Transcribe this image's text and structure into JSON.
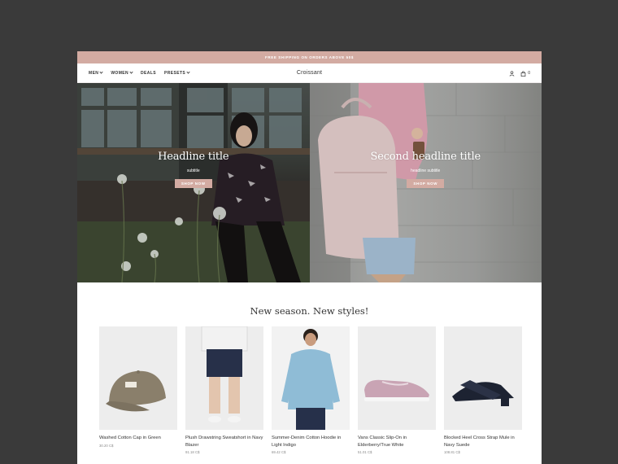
{
  "announcement": "FREE SHIPPING ON ORDERS ABOVE 50$",
  "nav": {
    "brand": "Croissant",
    "items": [
      {
        "label": "MEN",
        "dropdown": true
      },
      {
        "label": "WOMEN",
        "dropdown": true
      },
      {
        "label": "DEALS",
        "dropdown": false
      },
      {
        "label": "PRESETS",
        "dropdown": true
      }
    ],
    "cart_count": "0",
    "icons": [
      "user-icon",
      "bag-icon"
    ]
  },
  "hero": [
    {
      "title": "Headline title",
      "subtitle": "subtitle",
      "button": "SHOP NOW"
    },
    {
      "title": "Second headline title",
      "subtitle": "headline subtitle",
      "button": "SHOP NOW"
    }
  ],
  "section_title": "New season. New styles!",
  "products": [
    {
      "name": "Washed Cotton Cap in Green",
      "price": "30.20 C$"
    },
    {
      "name": "Plush Drawstring Sweatshort in Navy Blazer",
      "price": "91.18 C$"
    },
    {
      "name": "Summer-Denim Cotton Hoodie in Light Indigo",
      "price": "69.42 C$"
    },
    {
      "name": "Vans Classic Slip-On in Elderberry/True White",
      "price": "51.01 C$"
    },
    {
      "name": "Blocked Heel Cross Strap Mule in Navy Suede",
      "price": "108.81 C$"
    }
  ],
  "colors": {
    "accent": "#d3aba2",
    "backdrop": "#3a3a3a"
  }
}
